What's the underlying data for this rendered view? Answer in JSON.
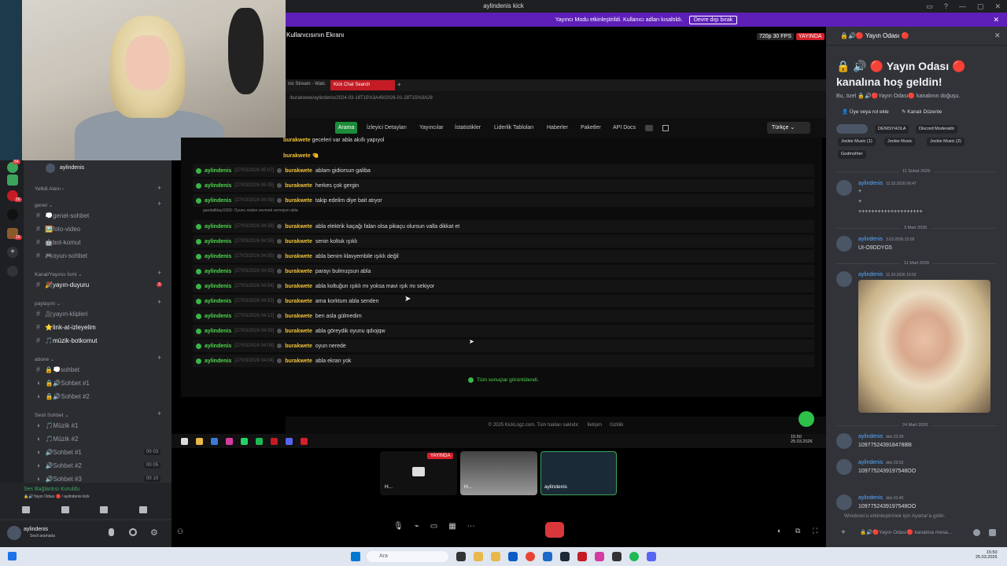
{
  "window": {
    "title": "aylindenis kick",
    "controls": [
      "▭",
      "?",
      "—",
      "▢",
      "✕"
    ]
  },
  "banner": {
    "text": "Yayıncı Modu etkinleştirildi. Kullanıcı adları kısaltıldı.",
    "button": "Devre dışı bırak",
    "close": "✕"
  },
  "stream": {
    "title": "Kullanıcısının Ekranı",
    "quality": "720p 30 FPS",
    "live": "YAYINDA"
  },
  "browser": {
    "tab1": "nis Stream - Watc",
    "tab2": "Kick Chat Search",
    "new_tab": "+",
    "url": "/burakwete/aylindenis/2024-03-18T15%3A49/2026-01-28T15%3A28",
    "nav": {
      "active": "Arama",
      "items": [
        "İzleyici Detayları",
        "Yayıncılar",
        "İstatistikler",
        "Liderlik Tabloları",
        "Haberler",
        "Paketler",
        "API Docs"
      ],
      "lang": "Türkçe"
    }
  },
  "chat": {
    "partial_top": [
      {
        "user": "burakwete",
        "msg": "geceleri var abla akıllı yapıyol"
      },
      {
        "user": "burakwete",
        "msg": "🤏"
      }
    ],
    "rows": [
      {
        "from": "aylindenis",
        "ts": "[27/03/2026 05:07]",
        "to": "burakwete",
        "msg": "ablam gidiorsun galiba"
      },
      {
        "from": "aylindenis",
        "ts": "[27/03/2026 05:05]",
        "to": "burakwete",
        "msg": "herkes çok gergin"
      },
      {
        "from": "aylindenis",
        "ts": "[27/03/2026 04:59]",
        "to": "burakwete",
        "msg": "takip edelim diye bait atıyor",
        "reply": "gandalfdayi1993: Oyunu neden sevmek vermiyon abla"
      },
      {
        "from": "aylindenis",
        "ts": "[27/03/2026 04:58]",
        "to": "burakwete",
        "msg": "abla elektrik kaçağı falan olsa pikaçu olursun valla dikkat et"
      },
      {
        "from": "aylindenis",
        "ts": "[27/03/2026 04:55]",
        "to": "burakwete",
        "msg": "senin koltuk ışıklı"
      },
      {
        "from": "aylindenis",
        "ts": "[27/03/2026 04:55]",
        "to": "burakwete",
        "msg": "abla benim klavyembile ışıklı değil"
      },
      {
        "from": "aylindenis",
        "ts": "[27/03/2026 04:55]",
        "to": "burakwete",
        "msg": "parayı bulmuşsun abla"
      },
      {
        "from": "aylindenis",
        "ts": "[27/03/2026 04:54]",
        "to": "burakwete",
        "msg": "abla koltuğun ışıklı mı yoksa mavi ışık mı sekiyor"
      },
      {
        "from": "aylindenis",
        "ts": "[27/03/2026 04:53]",
        "to": "burakwete",
        "msg": "ama korktum abla senden"
      },
      {
        "from": "aylindenis",
        "ts": "[27/03/2026 04:12]",
        "to": "burakwete",
        "msg": "ben asla gülmedim"
      },
      {
        "from": "aylindenis",
        "ts": "[27/03/2026 04:09]",
        "to": "burakwete",
        "msg": "abla göreydik oyunu qdıojqw"
      },
      {
        "from": "aylindenis",
        "ts": "[27/03/2026 04:06]",
        "to": "burakwete",
        "msg": "oyun nerede"
      },
      {
        "from": "aylindenis",
        "ts": "[27/03/2026 04:04]",
        "to": "burakwete",
        "msg": "abla ekran yok"
      }
    ],
    "all_results": "Tüm sonuçlar görüntülendi."
  },
  "page_footer": {
    "copyright": "© 2025 KickLogz.com. Tüm hakları saklıdır.",
    "contact": "İletişim",
    "privacy": "Gizlilik"
  },
  "inner_clock": {
    "time": "15:50",
    "date": "25.03.2026"
  },
  "discord_left": {
    "server": "aylindenis",
    "categories": [
      {
        "name": "Yetkili Alanı ›"
      },
      {
        "name": "genel ⌄"
      },
      {
        "name": "Kanal/Yayıncı İsmi ⌄"
      },
      {
        "name": "paylaşım ⌄"
      },
      {
        "name": "abone ⌄"
      },
      {
        "name": "Sesli Sohbet ⌄"
      }
    ],
    "genel": [
      "💭genel-sohbet",
      "🖼️foto-video",
      "🤖bot-komut",
      "🎮oyun-sohbet"
    ],
    "kanal": "🎉yayın-duyuru",
    "kanal_badge": "3",
    "paylasim": [
      "🎥yayın-klipleri",
      "⭐link-at-izleyelim",
      "🎵müzik-botkomut"
    ],
    "abone": [
      "🔒💭sohbet",
      "🔒🔊Sohbet #1",
      "🔒🔊Sohbet #2"
    ],
    "sesli": [
      {
        "name": "🎵Müzik #1"
      },
      {
        "name": "🎵Müzik #2"
      },
      {
        "name": "🔊Sohbet #1",
        "count_a": "00",
        "count_b": "03"
      },
      {
        "name": "🔊Sohbet #2",
        "count_a": "00",
        "count_b": "05"
      },
      {
        "name": "🔊Sohbet #3",
        "count_a": "00",
        "count_b": "10"
      }
    ],
    "voice_status": "Ses Bağlantısı Kuruldu",
    "voice_channel": "🔒🔊Yayın Odası 🔴 / aylindenis kick",
    "user": {
      "name": "aylindenis",
      "status": "Sesli aramada"
    }
  },
  "guild_badges": [
    "54",
    "16",
    "16"
  ],
  "tiles": [
    {
      "label": "H...",
      "live": "YAYINDA"
    },
    {
      "label": "H..."
    },
    {
      "label": "aylindenis"
    }
  ],
  "discord_right": {
    "header": "🔒🔊🔴 Yayın Odası 🔴",
    "welcome": "🔒 🔊 🔴 Yayın Odası 🔴 kanalına hoş geldin!",
    "welcome_sub": "Bu, özel 🔒🔊🔴Yayın Odası🔴 kanalının doğuşu.",
    "btn_role": "Üye veya rol ekle",
    "btn_edit": "Kanalı Düzenle",
    "pills": [
      "DENISYHOLA",
      "Discord Moderatör",
      "Jockie Music (1)",
      "Jockie Music",
      "Jockie Music (2)",
      "Godmother"
    ],
    "dates": [
      "11 Şubat 2026",
      "3 Mart 2026",
      "11 Mart 2026",
      "24 Mart 2026"
    ],
    "messages": [
      {
        "name": "aylindenis",
        "time": "11.02.2026 06:47",
        "lines": [
          "+",
          "+",
          "++++++++++++++++++++"
        ]
      },
      {
        "name": "aylindenis",
        "time": "3.03.2026 23:09",
        "lines": [
          "UI-O9DDYG5"
        ]
      },
      {
        "name": "aylindenis",
        "time": "11.03.2026 16:52",
        "lines": []
      },
      {
        "name": "aylindenis",
        "time": "dün 23:39",
        "lines": [
          "1097752439184788l8"
        ]
      },
      {
        "name": "aylindenis",
        "time": "dün 23:52",
        "lines": [
          "1097752439197548OO"
        ]
      },
      {
        "name": "aylindenis",
        "time": "dün 01:40",
        "lines": [
          "1097752439197548OO"
        ]
      }
    ],
    "watermark": "Windows'u etkinleştirmek için Ayarlar'a gidin.",
    "input_placeholder": "🔒🔊🔴Yayın Odası🔴 kanalına mesa..."
  },
  "taskbar": {
    "search": "Ara",
    "time": "15:50",
    "date": "25.03.2026"
  }
}
